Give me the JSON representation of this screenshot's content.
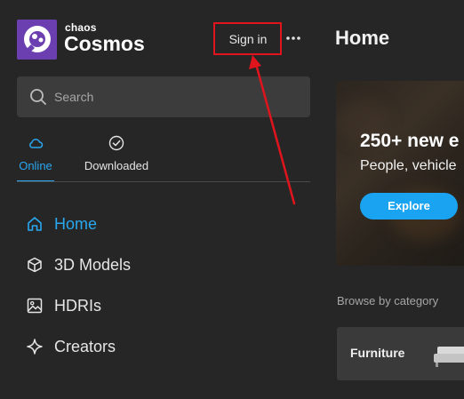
{
  "brand": {
    "small": "chaos",
    "big": "Cosmos"
  },
  "header": {
    "signin_label": "Sign in"
  },
  "search": {
    "placeholder": "Search"
  },
  "tabs": [
    {
      "label": "Online",
      "icon": "cloud-icon",
      "active": true
    },
    {
      "label": "Downloaded",
      "icon": "check-circle-icon",
      "active": false
    }
  ],
  "nav": [
    {
      "label": "Home",
      "icon": "home-icon",
      "active": true
    },
    {
      "label": "3D Models",
      "icon": "cube-icon",
      "active": false
    },
    {
      "label": "HDRIs",
      "icon": "image-icon",
      "active": false
    },
    {
      "label": "Creators",
      "icon": "sparkle-icon",
      "active": false
    }
  ],
  "main": {
    "title": "Home",
    "hero": {
      "title": "250+ new e",
      "subtitle": "People, vehicle",
      "button_label": "Explore"
    },
    "browse_label": "Browse by category",
    "categories": [
      {
        "label": "Furniture"
      }
    ]
  },
  "colors": {
    "accent": "#29a8f0",
    "annotation": "#e0141c",
    "logo": "#6b3fb0",
    "background": "#262626"
  }
}
